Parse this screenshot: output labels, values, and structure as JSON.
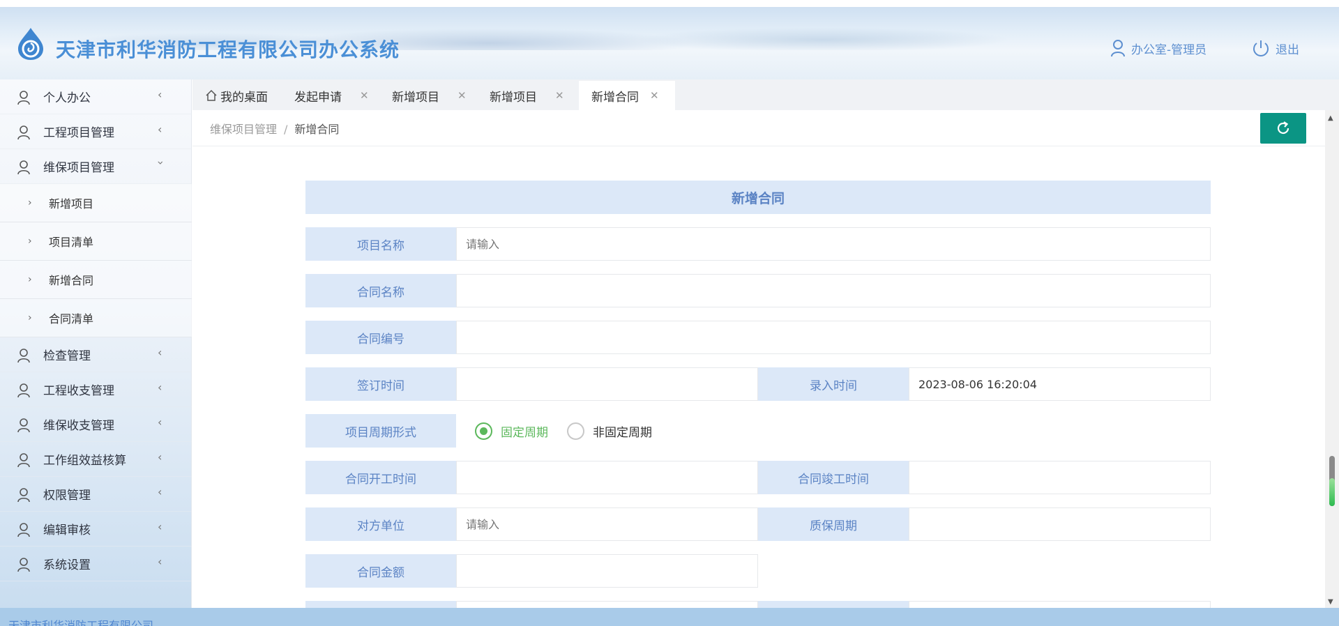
{
  "header": {
    "app_title": "天津市利华消防工程有限公司办公系统",
    "user_label": "办公室-管理员",
    "logout_label": "退出"
  },
  "sidebar": {
    "items": [
      {
        "label": "个人办公"
      },
      {
        "label": "工程项目管理"
      },
      {
        "label": "维保项目管理"
      },
      {
        "label": "检查管理"
      },
      {
        "label": "工程收支管理"
      },
      {
        "label": "维保收支管理"
      },
      {
        "label": "工作组效益核算"
      },
      {
        "label": "权限管理"
      },
      {
        "label": "编辑审核"
      },
      {
        "label": "系统设置"
      }
    ],
    "sub_items": [
      {
        "label": "新增项目"
      },
      {
        "label": "项目清单"
      },
      {
        "label": "新增合同"
      },
      {
        "label": "合同清单"
      }
    ]
  },
  "tabs": [
    {
      "label": "我的桌面"
    },
    {
      "label": "发起申请"
    },
    {
      "label": "新增项目"
    },
    {
      "label": "新增项目"
    },
    {
      "label": "新增合同"
    }
  ],
  "breadcrumb": {
    "parent": "维保项目管理",
    "separator": "/",
    "current": "新增合同"
  },
  "form": {
    "title": "新增合同",
    "project_name_label": "项目名称",
    "project_name_placeholder": "请输入",
    "contract_name_label": "合同名称",
    "contract_no_label": "合同编号",
    "sign_time_label": "签订时间",
    "entry_time_label": "录入时间",
    "entry_time_value": "2023-08-06 16:20:04",
    "cycle_form_label": "项目周期形式",
    "cycle_options": [
      "固定周期",
      "非固定周期"
    ],
    "cycle_selected": "固定周期",
    "start_time_label": "合同开工时间",
    "finish_time_label": "合同竣工时间",
    "counterparty_label": "对方单位",
    "counterparty_placeholder": "请输入",
    "warranty_label": "质保周期",
    "amount_label": "合同金额"
  },
  "footer": {
    "text": "天津市利华消防工程有限公司"
  },
  "colors": {
    "accent_teal": "#0b9584",
    "label_bg": "#dce8f8",
    "label_text": "#5b83c4",
    "radio_green": "#5cb85c",
    "title_blue": "#4a8fd6"
  }
}
